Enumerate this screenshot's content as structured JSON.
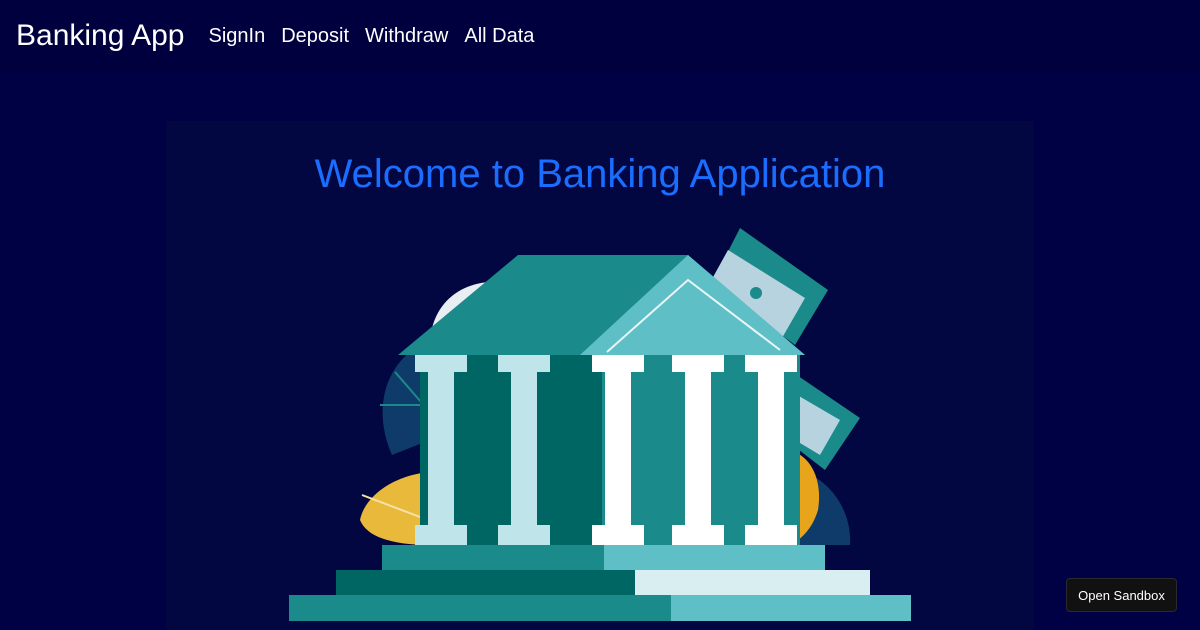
{
  "navbar": {
    "brand": "Banking App",
    "links": [
      {
        "label": "SignIn"
      },
      {
        "label": "Deposit"
      },
      {
        "label": "Withdraw"
      },
      {
        "label": "All Data"
      }
    ]
  },
  "main": {
    "title": "Welcome to Banking Application",
    "illustration": {
      "icon": "bank-building-icon",
      "colors": {
        "teal_dark": "#006664",
        "teal": "#1a8a8a",
        "teal_light": "#5fbfc6",
        "column_white": "#ffffff",
        "column_pale": "#bfe4ea",
        "banknote": "#b8d3e0",
        "coin": "#e8b93b",
        "leaf": "#0e3b6a"
      }
    }
  },
  "sandbox": {
    "label": "Open Sandbox"
  },
  "colors": {
    "background": "#000145",
    "navbar": "#00003f",
    "card": "#030741",
    "title": "#1a6dff"
  }
}
